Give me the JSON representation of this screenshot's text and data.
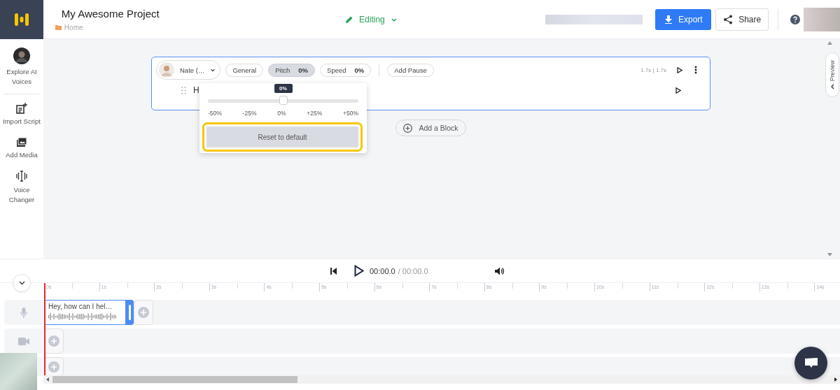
{
  "header": {
    "project_title": "My Awesome Project",
    "breadcrumb": "Home",
    "mode": "Editing",
    "export_label": "Export",
    "share_label": "Share"
  },
  "sidebar": {
    "items": [
      {
        "kind": "avatar",
        "label": "Explore AI Voices"
      },
      {
        "kind": "import",
        "label": "Import Script"
      },
      {
        "kind": "media",
        "label": "Add Media"
      },
      {
        "kind": "voice",
        "label": "Voice Changer"
      }
    ]
  },
  "block": {
    "voice": "Nate (…",
    "chips": [
      {
        "label": "General",
        "selected": false
      },
      {
        "label": "Pitch",
        "value": "0%",
        "selected": true
      },
      {
        "label": "Speed",
        "value": "0%",
        "selected": false
      }
    ],
    "add_pause": "Add Pause",
    "duration": "1.7s | 1.7s",
    "text": "H"
  },
  "pitch_popover": {
    "tooltip": "0%",
    "level": 0.5,
    "ticks": [
      "-50%",
      "-25%",
      "0%",
      "+25%",
      "+50%"
    ],
    "reset_label": "Reset to default",
    "highlighted": true
  },
  "add_block": "Add a Block",
  "preview_tab": "Preview",
  "player": {
    "current_time": "00:00.0",
    "total_time": "/ 00:00.0"
  },
  "timeline": {
    "ruler": [
      "0s",
      "1s",
      "2s",
      "3s",
      "4s",
      "5s",
      "6s",
      "7s",
      "8s",
      "9s",
      "10s",
      "11s",
      "12s",
      "13s",
      "14s"
    ],
    "tracks": [
      {
        "kind": "audio",
        "clips": [
          {
            "text": "Hey, how can I hel…",
            "selected": true
          }
        ]
      },
      {
        "kind": "video"
      },
      {
        "kind": "other"
      }
    ]
  }
}
